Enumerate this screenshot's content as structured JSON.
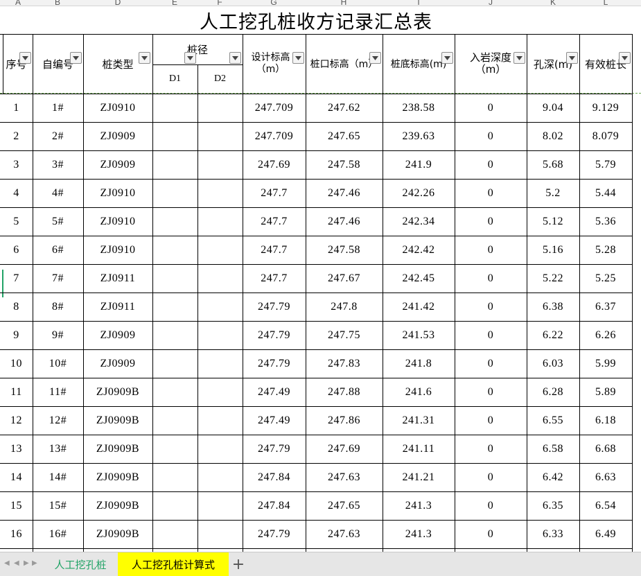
{
  "column_letters": [
    "A",
    "B",
    "D",
    "E",
    "F",
    "G",
    "H",
    "I",
    "J",
    "K",
    "L"
  ],
  "title": "人工挖孔桩收方记录汇总表",
  "headers": {
    "seq": "序号",
    "self_no": "自编号",
    "pile_type": "桩类型",
    "pile_diameter": "桩径",
    "d1": "D1",
    "d2": "D2",
    "design_elev_line1": "设计标高",
    "design_elev_line2": "（m）",
    "pile_top_elev": "桩口标高（m）",
    "pile_bottom_elev": "桩底标高(m)",
    "rock_depth_line1": "入岩深度",
    "rock_depth_line2": "（m）",
    "hole_depth": "孔深(m)",
    "effective_length": "有效桩长"
  },
  "rows": [
    [
      "1",
      "1#",
      "ZJ0910",
      "",
      "",
      "247.709",
      "247.62",
      "238.58",
      "0",
      "9.04",
      "9.129"
    ],
    [
      "2",
      "2#",
      "ZJ0909",
      "",
      "",
      "247.709",
      "247.65",
      "239.63",
      "0",
      "8.02",
      "8.079"
    ],
    [
      "3",
      "3#",
      "ZJ0909",
      "",
      "",
      "247.69",
      "247.58",
      "241.9",
      "0",
      "5.68",
      "5.79"
    ],
    [
      "4",
      "4#",
      "ZJ0910",
      "",
      "",
      "247.7",
      "247.46",
      "242.26",
      "0",
      "5.2",
      "5.44"
    ],
    [
      "5",
      "5#",
      "ZJ0910",
      "",
      "",
      "247.7",
      "247.46",
      "242.34",
      "0",
      "5.12",
      "5.36"
    ],
    [
      "6",
      "6#",
      "ZJ0910",
      "",
      "",
      "247.7",
      "247.58",
      "242.42",
      "0",
      "5.16",
      "5.28"
    ],
    [
      "7",
      "7#",
      "ZJ0911",
      "",
      "",
      "247.7",
      "247.67",
      "242.45",
      "0",
      "5.22",
      "5.25"
    ],
    [
      "8",
      "8#",
      "ZJ0911",
      "",
      "",
      "247.79",
      "247.8",
      "241.42",
      "0",
      "6.38",
      "6.37"
    ],
    [
      "9",
      "9#",
      "ZJ0909",
      "",
      "",
      "247.79",
      "247.75",
      "241.53",
      "0",
      "6.22",
      "6.26"
    ],
    [
      "10",
      "10#",
      "ZJ0909",
      "",
      "",
      "247.79",
      "247.83",
      "241.8",
      "0",
      "6.03",
      "5.99"
    ],
    [
      "11",
      "11#",
      "ZJ0909B",
      "",
      "",
      "247.49",
      "247.88",
      "241.6",
      "0",
      "6.28",
      "5.89"
    ],
    [
      "12",
      "12#",
      "ZJ0909B",
      "",
      "",
      "247.49",
      "247.86",
      "241.31",
      "0",
      "6.55",
      "6.18"
    ],
    [
      "13",
      "13#",
      "ZJ0909B",
      "",
      "",
      "247.79",
      "247.69",
      "241.11",
      "0",
      "6.58",
      "6.68"
    ],
    [
      "14",
      "14#",
      "ZJ0909B",
      "",
      "",
      "247.84",
      "247.63",
      "241.21",
      "0",
      "6.42",
      "6.63"
    ],
    [
      "15",
      "15#",
      "ZJ0909B",
      "",
      "",
      "247.84",
      "247.65",
      "241.3",
      "0",
      "6.35",
      "6.54"
    ],
    [
      "16",
      "16#",
      "ZJ0909B",
      "",
      "",
      "247.79",
      "247.63",
      "241.3",
      "0",
      "6.33",
      "6.49"
    ]
  ],
  "tabs": {
    "tab1": "人工挖孔桩",
    "tab2": "人工挖孔桩计算式",
    "add": "+"
  },
  "nav": {
    "first": "◀",
    "prev": "◀",
    "next": "▶",
    "last": "▶"
  },
  "colors": {
    "active_tab_text": "#21a366",
    "highlight_tab_bg": "#ffff00",
    "grid_line": "#000000"
  }
}
